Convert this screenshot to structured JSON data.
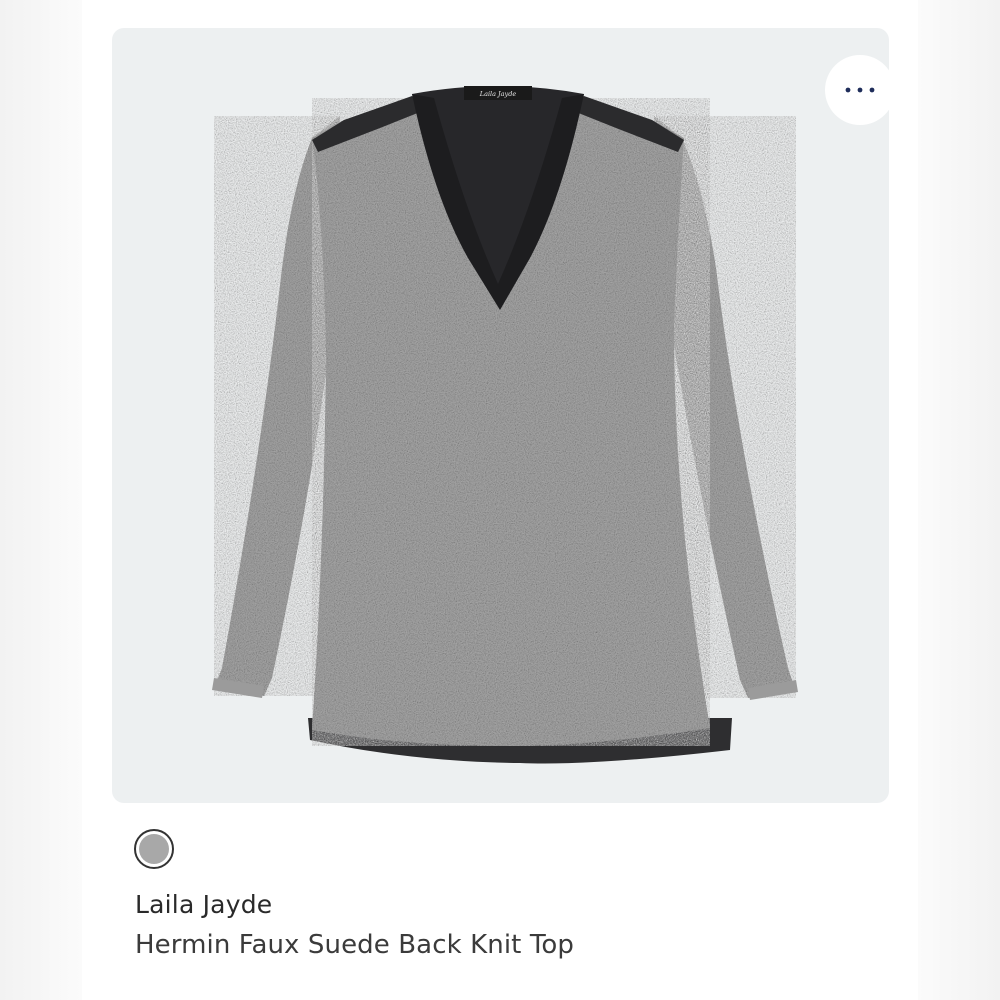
{
  "product": {
    "brand": "Laila Jayde",
    "name": "Hermin Faux Suede Back Knit Top",
    "label_text": "Laila Jayde"
  },
  "swatch": {
    "color": "#a8a8a8",
    "selected": true
  },
  "menu": {
    "icon": "more-horizontal-icon",
    "icon_color": "#1f2d5a"
  },
  "colors": {
    "panel_bg": "#edf0f1",
    "heather_gray": "#a9a9a9",
    "black_panel": "#2b2b2d"
  }
}
